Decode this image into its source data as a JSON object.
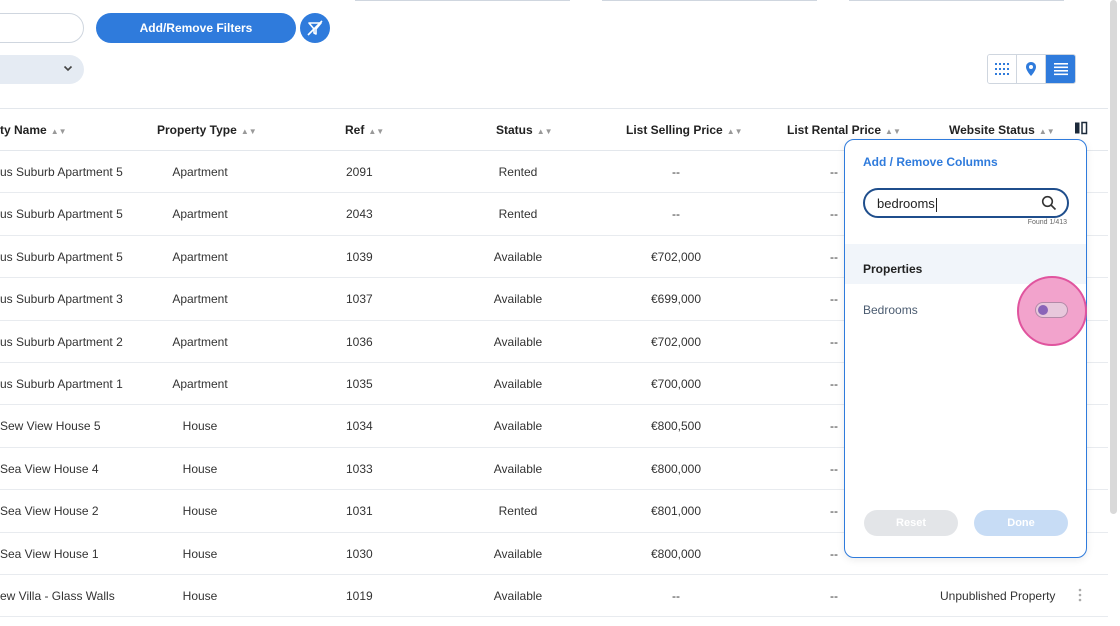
{
  "toolbar": {
    "filters_label": "Add/Remove Filters"
  },
  "table": {
    "columns": {
      "name": "ty Name",
      "type": "Property Type",
      "ref": "Ref",
      "status": "Status",
      "sell": "List Selling Price",
      "rent": "List Rental Price",
      "web": "Website Status"
    },
    "rows": [
      {
        "name": "us Suburb Apartment 5",
        "type": "Apartment",
        "ref": "2091",
        "status": "Rented",
        "sell": "--",
        "rent": "--",
        "web": ""
      },
      {
        "name": "us Suburb Apartment 5",
        "type": "Apartment",
        "ref": "2043",
        "status": "Rented",
        "sell": "--",
        "rent": "--",
        "web": ""
      },
      {
        "name": "us Suburb Apartment 5",
        "type": "Apartment",
        "ref": "1039",
        "status": "Available",
        "sell": "€702,000",
        "rent": "--",
        "web": ""
      },
      {
        "name": "us Suburb Apartment 3",
        "type": "Apartment",
        "ref": "1037",
        "status": "Available",
        "sell": "€699,000",
        "rent": "--",
        "web": ""
      },
      {
        "name": "us Suburb Apartment 2",
        "type": "Apartment",
        "ref": "1036",
        "status": "Available",
        "sell": "€702,000",
        "rent": "--",
        "web": ""
      },
      {
        "name": "us Suburb Apartment 1",
        "type": "Apartment",
        "ref": "1035",
        "status": "Available",
        "sell": "€700,000",
        "rent": "--",
        "web": ""
      },
      {
        "name": "Sew View House 5",
        "type": "House",
        "ref": "1034",
        "status": "Available",
        "sell": "€800,500",
        "rent": "--",
        "web": ""
      },
      {
        "name": "Sea View House 4",
        "type": "House",
        "ref": "1033",
        "status": "Available",
        "sell": "€800,000",
        "rent": "--",
        "web": ""
      },
      {
        "name": "Sea View House 2",
        "type": "House",
        "ref": "1031",
        "status": "Rented",
        "sell": "€801,000",
        "rent": "--",
        "web": ""
      },
      {
        "name": "Sea View House 1",
        "type": "House",
        "ref": "1030",
        "status": "Available",
        "sell": "€800,000",
        "rent": "--",
        "web": ""
      },
      {
        "name": "ew Villa - Glass Walls",
        "type": "House",
        "ref": "1019",
        "status": "Available",
        "sell": "--",
        "rent": "--",
        "web": "Unpublished Property"
      }
    ]
  },
  "panel": {
    "title": "Add / Remove Columns",
    "search_value": "bedrooms",
    "found": "Found 1/413",
    "group_label": "Properties",
    "item_label": "Bedrooms",
    "item_enabled": false,
    "reset_label": "Reset",
    "done_label": "Done"
  },
  "icons": {
    "clear_filter": "filter-off-icon",
    "select_chevron": "chevron-down-icon",
    "grid_view": "grid-view-icon",
    "map_view": "map-pin-icon",
    "list_view": "list-view-icon",
    "columns": "columns-icon",
    "search": "search-icon",
    "row_menu": "kebab-menu-icon"
  },
  "colors": {
    "primary": "#2f7bdc",
    "highlight": "#e0549e"
  }
}
